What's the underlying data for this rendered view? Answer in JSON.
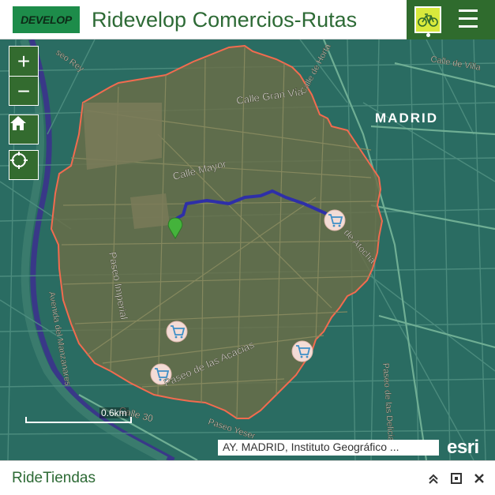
{
  "header": {
    "logo_text": "DEVELOP",
    "title": "Ridevelop Comercios-Rutas",
    "bike_icon": "bicycle-icon",
    "menu_icon": "hamburger-menu-icon",
    "accent_color": "#2f6b2d",
    "active_color": "#d8e93c"
  },
  "map": {
    "labels": {
      "madrid": "MADRID",
      "calle_gran_via": "Calle Gran Vía",
      "calle_mayor": "Calle Mayor",
      "paseo_imperial": "Paseo Imperial",
      "paseo_acacias": "Paseo de las Acacias",
      "avenida_manzanares": "Avenida del Manzanares",
      "calle_30": "Calle 30",
      "calle_atocha": "de Atocha",
      "calle_delicias": "Paseo de las Delicias",
      "calle_villa": "Calle de Villa",
      "paseo_rey": "seo Rey",
      "calle_horta": "Calle de Horta",
      "paseo_yeseras": "Paseo Yeser"
    },
    "scale_label": "0.6km",
    "attribution": "AY. MADRID, Instituto Geográfico ...",
    "esri_logo": "esri",
    "district_outline_color": "#f26b4f",
    "route_color": "#2e2fa8",
    "marker_color": "#44b33b",
    "zoom_in_label": "+",
    "zoom_out_label": "−",
    "home_icon": "home-icon",
    "locate_icon": "locate-icon",
    "cart_icon": "shopping-cart-icon",
    "pin_icon": "location-pin-icon"
  },
  "panel": {
    "title": "RideTiendas",
    "collapse_icon": "double-chevron-up-icon",
    "maximize_icon": "maximize-icon",
    "close_icon": "close-icon"
  }
}
